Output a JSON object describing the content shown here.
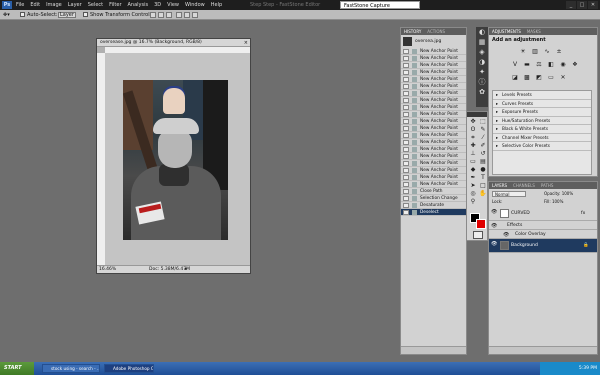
{
  "app": {
    "logo": "Ps",
    "menus": [
      "File",
      "Edit",
      "Image",
      "Layer",
      "Select",
      "Filter",
      "Analysis",
      "3D",
      "View",
      "Window",
      "Help"
    ],
    "doc_title": "Step Step - FastStone Editor",
    "capture_window": "FastStone Capture",
    "window_buttons": [
      "_",
      "□",
      "✕"
    ]
  },
  "options_bar": {
    "auto_select_label": "Auto-Select:",
    "auto_select_value": "Layer",
    "show_transform_label": "Show Transform Controls"
  },
  "document": {
    "title": "oversease.jpg @ 16.7% (Background, RGB/8)",
    "zoom": "16.46%",
    "doc_size": "Doc: 5.38M/6.47M"
  },
  "history": {
    "tabs": [
      "HISTORY",
      "ACTIONS"
    ],
    "snapshot_label": "oversea.jpg",
    "items": [
      "New Anchor Point",
      "New Anchor Point",
      "New Anchor Point",
      "New Anchor Point",
      "New Anchor Point",
      "New Anchor Point",
      "New Anchor Point",
      "New Anchor Point",
      "New Anchor Point",
      "New Anchor Point",
      "New Anchor Point",
      "New Anchor Point",
      "New Anchor Point",
      "New Anchor Point",
      "New Anchor Point",
      "New Anchor Point",
      "New Anchor Point",
      "New Anchor Point",
      "New Anchor Point",
      "New Anchor Point",
      "Close Path",
      "Selection Change",
      "Desaturate",
      "Deselect"
    ],
    "selected_index": 23
  },
  "adjustments": {
    "tabs": [
      "ADJUSTMENTS",
      "MASKS"
    ],
    "heading": "Add an adjustment",
    "presets": [
      "Levels Presets",
      "Curves Presets",
      "Exposure Presets",
      "Hue/Saturation Presets",
      "Black & White Presets",
      "Channel Mixer Presets",
      "Selective Color Presets"
    ]
  },
  "layers": {
    "tabs": [
      "LAYERS",
      "CHANNELS",
      "PATHS"
    ],
    "blend_mode": "Normal",
    "opacity_label": "Opacity: 100%",
    "lock_label": "Lock:",
    "fill_label": "Fill: 100%",
    "rows": [
      {
        "name": "CURVED",
        "fx": "fx"
      },
      {
        "name": "Effects"
      },
      {
        "name": "Color Overlay"
      },
      {
        "name": "Background"
      }
    ]
  },
  "taskbar": {
    "start_label": "START",
    "tasks": [
      "stock using - search - ...",
      "Adobe Photoshop CS4 ..."
    ],
    "clock": "5:39 PM"
  },
  "colors": {
    "foreground": "#000000",
    "background": "#e00000",
    "selection": "#1f3a5f"
  }
}
